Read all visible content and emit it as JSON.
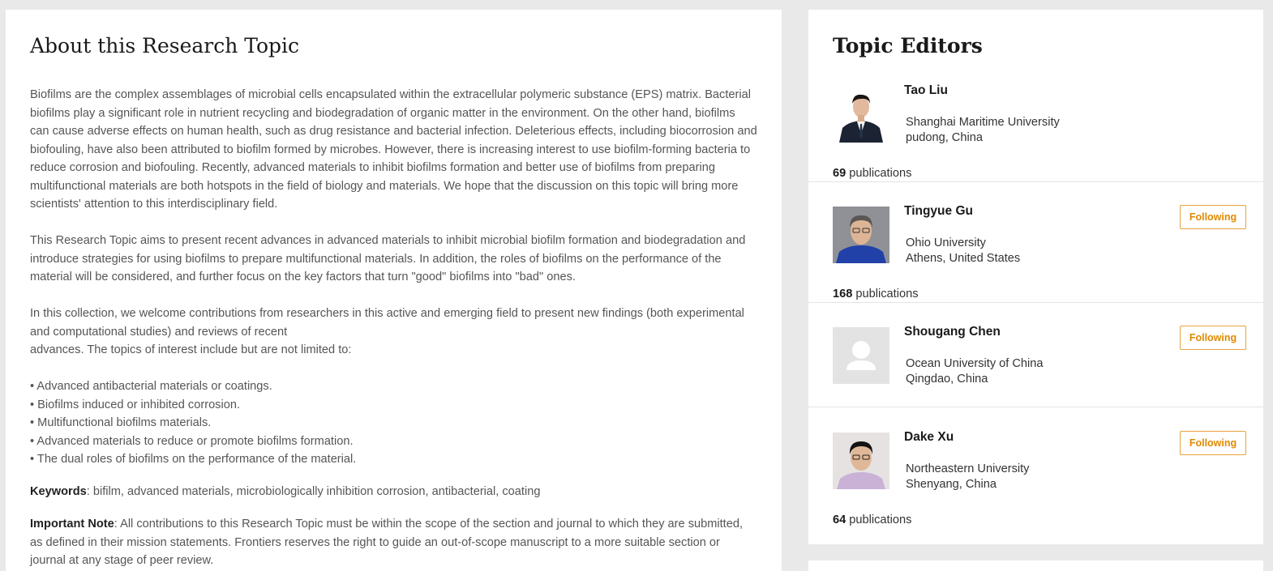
{
  "about": {
    "title": "About this Research Topic",
    "para1": "Biofilms are the complex assemblages of microbial cells encapsulated within the extracellular polymeric substance (EPS) matrix. Bacterial biofilms play a significant role in nutrient recycling and biodegradation of organic matter in the environment. On the other hand, biofilms can cause adverse effects on human health, such as drug resistance and bacterial infection. Deleterious effects, including biocorrosion and biofouling, have also been attributed to biofilm formed by microbes. However, there is increasing interest to use biofilm-forming bacteria to reduce corrosion and biofouling. Recently, advanced materials to inhibit biofilms formation and better use of biofilms from preparing multifunctional materials are both hotspots in the field of biology and materials. We hope that the discussion on this topic will bring more scientists' attention to this interdisciplinary field.",
    "para2": "This Research Topic aims to present recent advances in advanced materials to inhibit microbial biofilm formation and biodegradation and introduce strategies for using biofilms to prepare multifunctional materials. In addition, the roles of biofilms on the performance of the material will be considered, and further focus on the key factors that turn \"good\" biofilms into \"bad\" ones.",
    "para3_line1": "In this collection, we welcome contributions from researchers in this active and emerging field to present new findings (both experimental and computational studies) and reviews of recent",
    "para3_line2": "advances. The topics of interest include but are not limited to:",
    "bullets": [
      "Advanced antibacterial materials or coatings.",
      "Biofilms induced or inhibited corrosion.",
      "Multifunctional biofilms materials.",
      "Advanced materials to reduce or promote biofilms formation.",
      "The dual roles of biofilms on the performance of the material."
    ],
    "keywords_label": "Keywords",
    "keywords_text": ": bifilm, advanced materials, microbiologically inhibition corrosion, antibacterial, coating",
    "note_label": "Important Note",
    "note_text": ": All contributions to this Research Topic must be within the scope of the section and journal to which they are submitted, as defined in their mission statements. Frontiers reserves the right to guide an out-of-scope manuscript to a more suitable section or journal at any stage of peer review."
  },
  "editors": {
    "title": "Topic Editors",
    "publications_label": "publications",
    "follow_label": "Following",
    "items": [
      {
        "name": "Tao Liu",
        "institution": "Shanghai Maritime University",
        "location": "pudong, China",
        "publications": "69"
      },
      {
        "name": "Tingyue Gu",
        "institution": "Ohio University",
        "location": "Athens, United States",
        "publications": "168"
      },
      {
        "name": "Shougang Chen",
        "institution": "Ocean University of China",
        "location": "Qingdao, China"
      },
      {
        "name": "Dake Xu",
        "institution": "Northeastern University",
        "location": "Shenyang, China",
        "publications": "64"
      }
    ]
  },
  "colors": {
    "accent": "#e08a00",
    "background": "#e9e9e9"
  }
}
